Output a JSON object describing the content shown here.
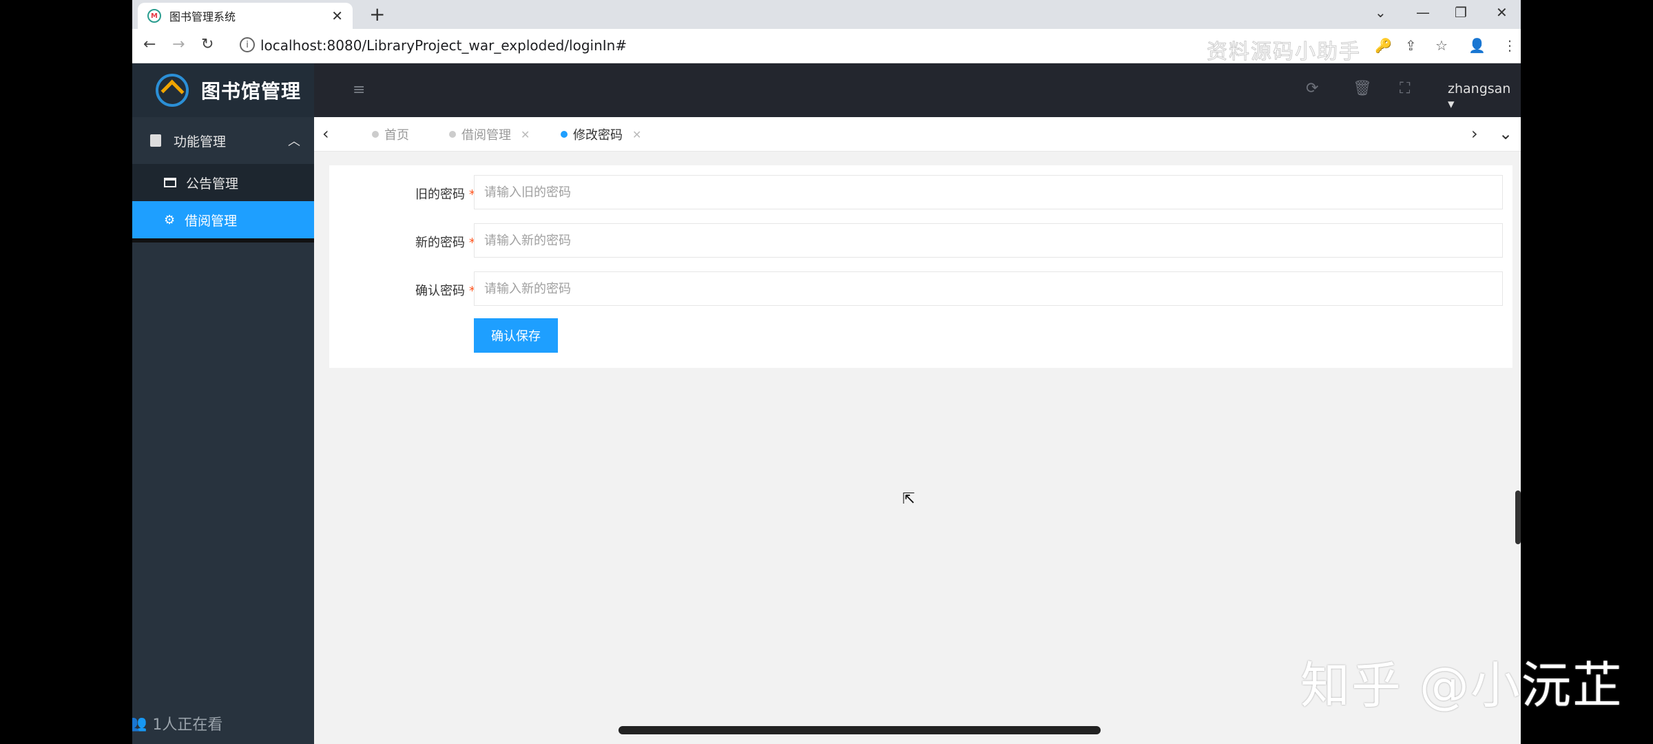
{
  "browser": {
    "tab_title": "图书管理系统",
    "tab_close": "✕",
    "new_tab": "+",
    "url": "localhost:8080/LibraryProject_war_exploded/loginIn#",
    "watermark": "资料源码小助手",
    "window_controls": [
      "⌄",
      "—",
      "❐",
      "✕"
    ],
    "nav_back": "←",
    "nav_forward": "→",
    "nav_reload": "↻",
    "info_icon": "i",
    "actions": [
      "🔑",
      "⇪",
      "☆",
      "👤",
      "⋮"
    ]
  },
  "app": {
    "logo_text": "图书馆管理",
    "user": "zhangsan ▾",
    "toolbar_icons": [
      "⟳",
      "🗑",
      "⛶"
    ],
    "menu_icon": "≡"
  },
  "sidebar": {
    "group_label": "功能管理",
    "group_chevron": "︿",
    "items": [
      {
        "label": "公告管理",
        "active": false
      },
      {
        "label": "借阅管理",
        "active": true
      }
    ],
    "viewers": "1人正在看"
  },
  "tabs": {
    "left_arrow": "‹",
    "right_arrow": "›",
    "more": "⌄",
    "items": [
      {
        "label": "首页",
        "active": false,
        "closable": false,
        "close": ""
      },
      {
        "label": "借阅管理",
        "active": false,
        "closable": true,
        "close": "✕"
      },
      {
        "label": "修改密码",
        "active": true,
        "closable": true,
        "close": "✕"
      }
    ]
  },
  "form": {
    "old_label": "旧的密码",
    "old_placeholder": "请输入旧的密码",
    "new_label": "新的密码",
    "new_placeholder": "请输入新的密码",
    "confirm_label": "确认密码",
    "confirm_placeholder": "请输入新的密码",
    "required_mark": "*",
    "save_label": "确认保存"
  },
  "overlay": {
    "zhihu_watermark": "知乎 @小沅芷"
  },
  "colors": {
    "accent": "#1e9fff",
    "sidebar": "#28333e",
    "topbar": "#23262e",
    "required": "#ff5722"
  }
}
